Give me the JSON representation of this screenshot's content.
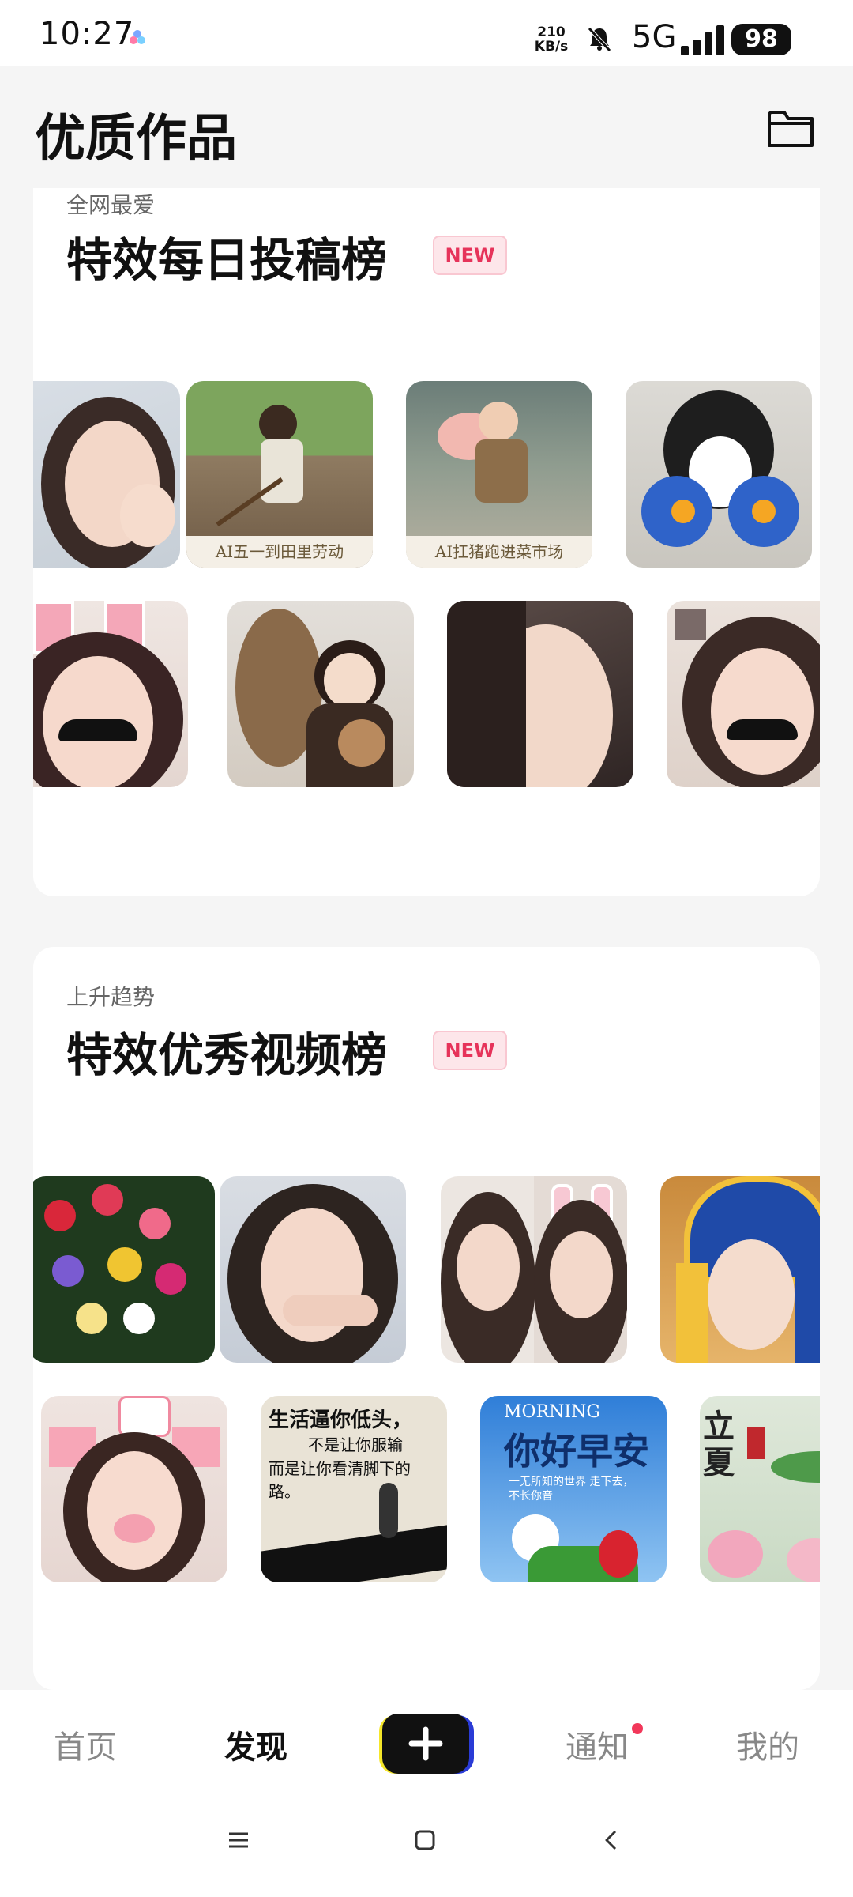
{
  "status_bar": {
    "time": "10:27",
    "speed_value": "210",
    "speed_unit": "KB/s",
    "network": "5G",
    "battery": "98"
  },
  "header": {
    "title": "优质作品",
    "folder_icon": "folder-icon"
  },
  "sections": [
    {
      "subtitle": "全网最爱",
      "title": "特效每日投稿榜",
      "badge": "NEW",
      "items": [
        {
          "caption": ""
        },
        {
          "caption": "AI五一到田里劳动"
        },
        {
          "caption": "AI扛猪跑进菜市场"
        },
        {
          "caption": ""
        },
        {
          "caption": ""
        },
        {
          "caption": ""
        },
        {
          "caption": ""
        },
        {
          "caption": ""
        }
      ]
    },
    {
      "subtitle": "上升趋势",
      "title": "特效优秀视频榜",
      "badge": "NEW",
      "items": [
        {
          "caption": ""
        },
        {
          "caption": ""
        },
        {
          "caption": ""
        },
        {
          "caption": ""
        },
        {
          "caption": ""
        },
        {
          "caption": "",
          "text_line1": "生活逼你低头，",
          "text_line2": "不是让你服输",
          "text_line3": "而是让你看清脚下的路。"
        },
        {
          "caption": "",
          "text_top": "MORNING",
          "text_main": "你好早安",
          "text_sub": "一无所知的世界 走下去，不长你音"
        },
        {
          "caption": "",
          "text_main": "立夏"
        }
      ]
    }
  ],
  "bottom_nav": {
    "items": [
      "首页",
      "发现",
      "通知",
      "我的"
    ],
    "active": "发现",
    "create_icon": "plus-icon"
  },
  "colors": {
    "accent": "#e6335a",
    "background": "#f5f5f5",
    "card": "#ffffff"
  }
}
